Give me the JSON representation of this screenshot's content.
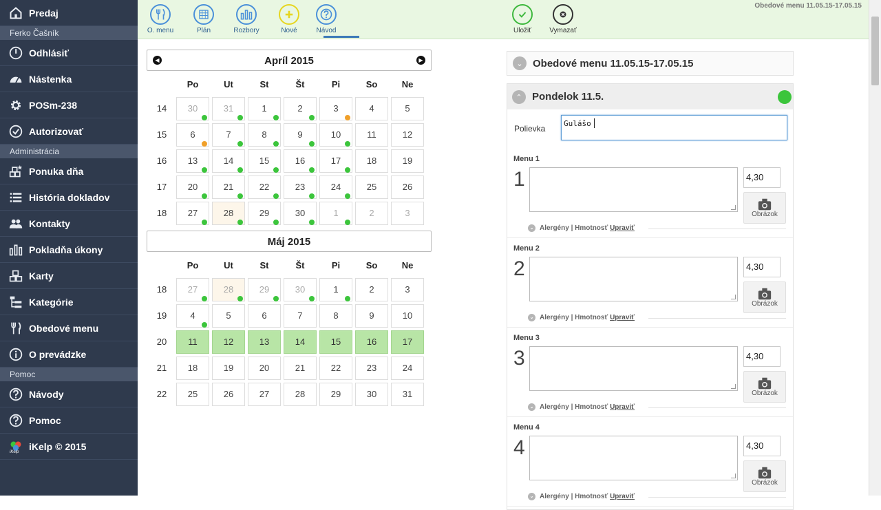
{
  "sidebar": {
    "items": [
      {
        "label": "Predaj",
        "icon": "home-icon"
      },
      {
        "section": "Ferko Čašník"
      },
      {
        "label": "Odhlásiť",
        "icon": "power-icon"
      },
      {
        "label": "Nástenka",
        "icon": "dashboard-icon"
      },
      {
        "label": "POSm-238",
        "icon": "gear-icon"
      },
      {
        "label": "Autorizovať",
        "icon": "check-circle-icon"
      },
      {
        "section": "Administrácia"
      },
      {
        "label": "Ponuka dňa",
        "icon": "boxes-star-icon"
      },
      {
        "label": "História dokladov",
        "icon": "list-icon"
      },
      {
        "label": "Kontakty",
        "icon": "users-icon"
      },
      {
        "label": "Pokladňa úkony",
        "icon": "bar-chart-icon"
      },
      {
        "label": "Karty",
        "icon": "boxes-icon"
      },
      {
        "label": "Kategórie",
        "icon": "tree-icon"
      },
      {
        "label": "Obedové menu",
        "icon": "cutlery-icon"
      },
      {
        "label": "O prevádzke",
        "icon": "info-icon"
      },
      {
        "section": "Pomoc"
      },
      {
        "label": "Návody",
        "icon": "question-icon"
      },
      {
        "label": "Pomoc",
        "icon": "question-icon"
      },
      {
        "label": "iKelp © 2015",
        "icon": "ikelp-logo",
        "logo_text": "iKelp"
      }
    ]
  },
  "toolbar": {
    "buttons": [
      {
        "label": "O. menu",
        "icon": "cutlery-icon",
        "color": "#4a90d9"
      },
      {
        "label": "Plán",
        "icon": "calendar-grid-icon",
        "color": "#4a90d9",
        "active": true
      },
      {
        "label": "Rozbory",
        "icon": "bar-chart-icon",
        "color": "#4a90d9"
      },
      {
        "label": "Nové",
        "icon": "plus-icon",
        "color": "#e6d620"
      },
      {
        "label": "Návod",
        "icon": "question-icon",
        "color": "#4a90d9"
      },
      {
        "label": "Uložiť",
        "icon": "check-icon",
        "color": "#3db83d"
      },
      {
        "label": "Vymazať",
        "icon": "close-icon",
        "color": "#333333"
      }
    ],
    "title": "Obedové menu 11.05.15-17.05.15"
  },
  "calendars": [
    {
      "title": "Apríl 2015",
      "days": [
        "Po",
        "Ut",
        "St",
        "Št",
        "Pi",
        "So",
        "Ne"
      ],
      "weeks": [
        {
          "num": "14",
          "cells": [
            {
              "d": "30",
              "other": true,
              "dot": "g"
            },
            {
              "d": "31",
              "other": true,
              "dot": "g"
            },
            {
              "d": "1",
              "dot": "g"
            },
            {
              "d": "2",
              "dot": "g"
            },
            {
              "d": "3",
              "dot": "o"
            },
            {
              "d": "4"
            },
            {
              "d": "5"
            }
          ]
        },
        {
          "num": "15",
          "cells": [
            {
              "d": "6",
              "dot": "o"
            },
            {
              "d": "7",
              "dot": "g"
            },
            {
              "d": "8",
              "dot": "g"
            },
            {
              "d": "9",
              "dot": "g"
            },
            {
              "d": "10",
              "dot": "g"
            },
            {
              "d": "11"
            },
            {
              "d": "12"
            }
          ]
        },
        {
          "num": "16",
          "cells": [
            {
              "d": "13",
              "dot": "g"
            },
            {
              "d": "14",
              "dot": "g"
            },
            {
              "d": "15",
              "dot": "g"
            },
            {
              "d": "16",
              "dot": "g"
            },
            {
              "d": "17",
              "dot": "g"
            },
            {
              "d": "18"
            },
            {
              "d": "19"
            }
          ]
        },
        {
          "num": "17",
          "cells": [
            {
              "d": "20",
              "dot": "g"
            },
            {
              "d": "21",
              "dot": "g"
            },
            {
              "d": "22",
              "dot": "g"
            },
            {
              "d": "23",
              "dot": "g"
            },
            {
              "d": "24",
              "dot": "g"
            },
            {
              "d": "25"
            },
            {
              "d": "26"
            }
          ]
        },
        {
          "num": "18",
          "cells": [
            {
              "d": "27",
              "dot": "g"
            },
            {
              "d": "28",
              "today": true,
              "dot": "g"
            },
            {
              "d": "29",
              "dot": "g"
            },
            {
              "d": "30",
              "dot": "g"
            },
            {
              "d": "1",
              "other": true,
              "dot": "g"
            },
            {
              "d": "2",
              "other": true
            },
            {
              "d": "3",
              "other": true
            }
          ]
        }
      ]
    },
    {
      "title": "Máj 2015",
      "days": [
        "Po",
        "Ut",
        "St",
        "Št",
        "Pi",
        "So",
        "Ne"
      ],
      "weeks": [
        {
          "num": "18",
          "cells": [
            {
              "d": "27",
              "other": true,
              "dot": "g"
            },
            {
              "d": "28",
              "other": true,
              "today": true,
              "dot": "g"
            },
            {
              "d": "29",
              "other": true,
              "dot": "g"
            },
            {
              "d": "30",
              "other": true,
              "dot": "g"
            },
            {
              "d": "1",
              "dot": "g"
            },
            {
              "d": "2"
            },
            {
              "d": "3"
            }
          ]
        },
        {
          "num": "19",
          "cells": [
            {
              "d": "4",
              "dot": "g"
            },
            {
              "d": "5"
            },
            {
              "d": "6"
            },
            {
              "d": "7"
            },
            {
              "d": "8"
            },
            {
              "d": "9"
            },
            {
              "d": "10"
            }
          ]
        },
        {
          "num": "20",
          "cells": [
            {
              "d": "11",
              "sel": true
            },
            {
              "d": "12",
              "sel": true
            },
            {
              "d": "13",
              "sel": true
            },
            {
              "d": "14",
              "sel": true
            },
            {
              "d": "15",
              "sel": true
            },
            {
              "d": "16",
              "sel": true
            },
            {
              "d": "17",
              "sel": true
            }
          ]
        },
        {
          "num": "21",
          "cells": [
            {
              "d": "18"
            },
            {
              "d": "19"
            },
            {
              "d": "20"
            },
            {
              "d": "21"
            },
            {
              "d": "22"
            },
            {
              "d": "23"
            },
            {
              "d": "24"
            }
          ]
        },
        {
          "num": "22",
          "cells": [
            {
              "d": "25"
            },
            {
              "d": "26"
            },
            {
              "d": "27"
            },
            {
              "d": "28"
            },
            {
              "d": "29"
            },
            {
              "d": "30"
            },
            {
              "d": "31"
            }
          ]
        }
      ]
    }
  ],
  "menu_panel": {
    "header_title": "Obedové menu 11.05.15-17.05.15",
    "day_title": "Pondelok 11.5.",
    "day_status_color": "#3cc53c",
    "soup_label": "Polievka",
    "soup_value": "Gulášo",
    "items": [
      {
        "label": "Menu 1",
        "num": "1",
        "price": "4,30",
        "image_label": "Obrázok",
        "allergens": "Alergény | Hmotnosť",
        "edit": "Upraviť"
      },
      {
        "label": "Menu 2",
        "num": "2",
        "price": "4,30",
        "image_label": "Obrázok",
        "allergens": "Alergény | Hmotnosť",
        "edit": "Upraviť"
      },
      {
        "label": "Menu 3",
        "num": "3",
        "price": "4,30",
        "image_label": "Obrázok",
        "allergens": "Alergény | Hmotnosť",
        "edit": "Upraviť"
      },
      {
        "label": "Menu 4",
        "num": "4",
        "price": "4,30",
        "image_label": "Obrázok",
        "allergens": "Alergény | Hmotnosť",
        "edit": "Upraviť"
      }
    ]
  }
}
